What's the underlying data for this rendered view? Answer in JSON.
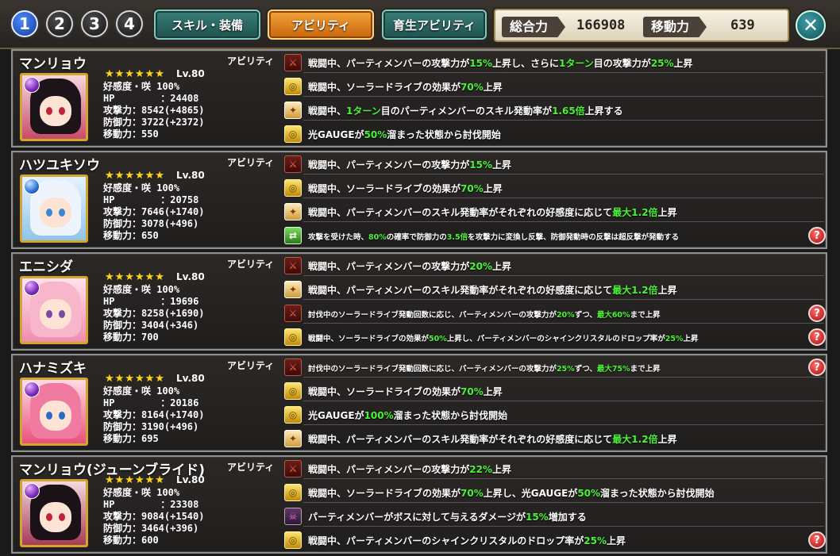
{
  "party_buttons": [
    "1",
    "2",
    "3",
    "4"
  ],
  "tabs": {
    "skill_equip": "スキル・装備",
    "ability": "アビリティ",
    "growth_ability": "育生アビリティ"
  },
  "stats": {
    "total_label": "総合力",
    "total_value": "166908",
    "move_label": "移動力",
    "move_value": "639"
  },
  "close_glyph": "✕",
  "ability_label": "アビリティ",
  "help_glyph": "?",
  "characters": [
    {
      "name": "マンリョウ",
      "stars": "★★★★★★",
      "level": "Lv.80",
      "affinity": "好感度・咲 100%",
      "hp": "HP        ：24408",
      "atk": "攻撃力：8542(+4865)",
      "def": "防御力：3722(+2372)",
      "move": "移動力：550",
      "abilities": [
        {
          "icon": "atk",
          "pre": "戦闘中、パーティメンバーの攻撃力が",
          "hl1": "15%",
          "mid": "上昇し、さらに",
          "hl2": "1ターン",
          "post": "目の攻撃力が",
          "hl3": "25%",
          "end": "上昇"
        },
        {
          "icon": "gold",
          "pre": "戦闘中、ソーラードライブの効果が",
          "hl1": "70%",
          "end": "上昇"
        },
        {
          "icon": "skill",
          "pre": "戦闘中、",
          "hl1": "1ターン",
          "mid": "目のパーティメンバーのスキル発動率が",
          "hl2": "1.65倍",
          "end": "上昇する"
        },
        {
          "icon": "gold",
          "pre": "光GAUGEが",
          "hl1": "50%",
          "end": "溜まった状態から討伐開始"
        }
      ]
    },
    {
      "name": "ハツユキソウ",
      "stars": "★★★★★★",
      "level": "Lv.80",
      "affinity": "好感度・咲 100%",
      "hp": "HP        ：20758",
      "atk": "攻撃力：7646(+1740)",
      "def": "防御力：3078(+496)",
      "move": "移動力：650",
      "abilities": [
        {
          "icon": "atk",
          "pre": "戦闘中、パーティメンバーの攻撃力が",
          "hl1": "15%",
          "end": "上昇"
        },
        {
          "icon": "gold",
          "pre": "戦闘中、ソーラードライブの効果が",
          "hl1": "70%",
          "end": "上昇"
        },
        {
          "icon": "skill",
          "pre": "戦闘中、パーティメンバーのスキル発動率がそれぞれの好感度に応じて",
          "hl1": "最大1.2倍",
          "end": "上昇"
        },
        {
          "icon": "green",
          "pre": "攻撃を受けた時、",
          "hl1": "80%",
          "mid": "の確率で防御力の",
          "hl2": "3.5倍",
          "end": "を攻撃力に変換し反撃、防御発動時の反撃は超反撃が発動する",
          "small": true
        }
      ]
    },
    {
      "name": "エニシダ",
      "stars": "★★★★★★",
      "level": "Lv.80",
      "affinity": "好感度・咲 100%",
      "hp": "HP        ：19696",
      "atk": "攻撃力：8258(+1690)",
      "def": "防御力：3404(+346)",
      "move": "移動力：700",
      "abilities": [
        {
          "icon": "atk",
          "pre": "戦闘中、パーティメンバーの攻撃力が",
          "hl1": "20%",
          "end": "上昇"
        },
        {
          "icon": "skill",
          "pre": "戦闘中、パーティメンバーのスキル発動率がそれぞれの好感度に応じて",
          "hl1": "最大1.2倍",
          "end": "上昇"
        },
        {
          "icon": "atk",
          "pre": "討伐中のソーラードライブ発動回数に応じ、パーティメンバーの攻撃力が",
          "hl1": "20%",
          "mid": "ずつ、",
          "hl2": "最大60%",
          "end": "まで上昇",
          "small": true
        },
        {
          "icon": "gold",
          "pre": "戦闘中、ソーラードライブの効果が",
          "hl1": "50%",
          "mid": "上昇し、パーティメンバーのシャインクリスタルのドロップ率が",
          "hl2": "25%",
          "end": "上昇",
          "small": true
        }
      ]
    },
    {
      "name": "ハナミズキ",
      "stars": "★★★★★★",
      "level": "Lv.80",
      "affinity": "好感度・咲 100%",
      "hp": "HP        ：20186",
      "atk": "攻撃力：8164(+1740)",
      "def": "防御力：3190(+496)",
      "move": "移動力：695",
      "abilities": [
        {
          "icon": "atk",
          "pre": "討伐中のソーラードライブ発動回数に応じ、パーティメンバーの攻撃力が",
          "hl1": "25%",
          "mid": "ずつ、",
          "hl2": "最大75%",
          "end": "まで上昇",
          "small": true
        },
        {
          "icon": "gold",
          "pre": "戦闘中、ソーラードライブの効果が",
          "hl1": "70%",
          "end": "上昇"
        },
        {
          "icon": "gold",
          "pre": "光GAUGEが",
          "hl1": "100%",
          "end": "溜まった状態から討伐開始"
        },
        {
          "icon": "skill",
          "pre": "戦闘中、パーティメンバーのスキル発動率がそれぞれの好感度に応じて",
          "hl1": "最大1.2倍",
          "end": "上昇"
        }
      ]
    },
    {
      "name": "マンリョウ(ジューンブライド)",
      "stars": "★★★★★★",
      "level": "Lv.80",
      "affinity": "好感度・咲 100%",
      "hp": "HP        ：23308",
      "atk": "攻撃力：9084(+1540)",
      "def": "防御力：3464(+396)",
      "move": "移動力：600",
      "abilities": [
        {
          "icon": "atk",
          "pre": "戦闘中、パーティメンバーの攻撃力が",
          "hl1": "22%",
          "end": "上昇"
        },
        {
          "icon": "gold",
          "pre": "戦闘中、ソーラードライブの効果が",
          "hl1": "70%",
          "mid": "上昇し、光GAUGEが",
          "hl2": "50%",
          "end": "溜まった状態から討伐開始"
        },
        {
          "icon": "boss",
          "pre": "パーティメンバーがボスに対して与えるダメージが",
          "hl1": "15%",
          "end": "増加する"
        },
        {
          "icon": "gold",
          "pre": "戦闘中、パーティメンバーのシャインクリスタルのドロップ率が",
          "hl1": "25%",
          "end": "上昇"
        }
      ]
    }
  ]
}
